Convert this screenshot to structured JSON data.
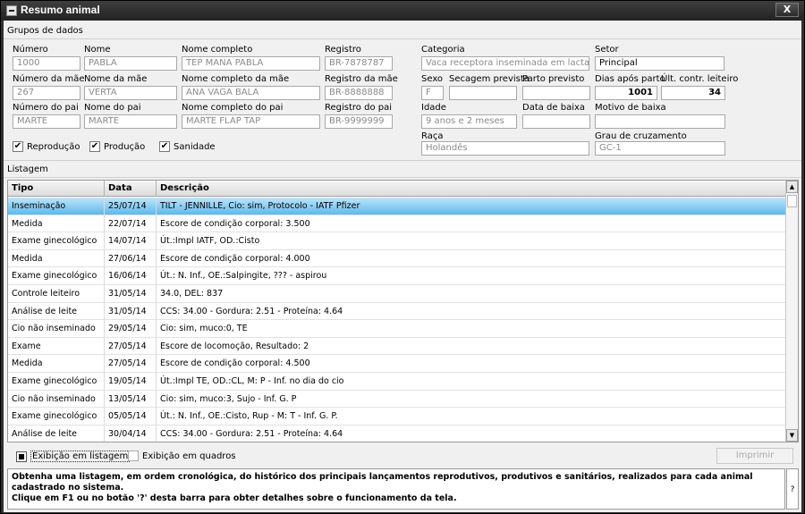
{
  "window": {
    "title": "Resumo animal",
    "close_label": "X"
  },
  "groups_label": "Grupos de dados",
  "fields": {
    "numero": {
      "label": "Número",
      "value": "1000"
    },
    "nome": {
      "label": "Nome",
      "value": "PABLA"
    },
    "nome_completo": {
      "label": "Nome completo",
      "value": "TEP MANA PABLA"
    },
    "registro": {
      "label": "Registro",
      "value": "BR-7878787"
    },
    "numero_mae": {
      "label": "Número da mãe",
      "value": "267"
    },
    "nome_mae": {
      "label": "Nome da mãe",
      "value": "VERTA"
    },
    "nome_completo_mae": {
      "label": "Nome completo da mãe",
      "value": "ANA VAGA BALA"
    },
    "registro_mae": {
      "label": "Registro da mãe",
      "value": "BR-8888888"
    },
    "numero_pai": {
      "label": "Número do pai",
      "value": "MARTE"
    },
    "nome_pai": {
      "label": "Nome do pai",
      "value": "MARTE"
    },
    "nome_completo_pai": {
      "label": "Nome completo do pai",
      "value": "MARTE FLAP TAP"
    },
    "registro_pai": {
      "label": "Registro do pai",
      "value": "BR-9999999"
    },
    "categoria": {
      "label": "Categoria",
      "value": "Vaca receptora inseminada em lactação"
    },
    "setor": {
      "label": "Setor",
      "value": "Principal"
    },
    "sexo": {
      "label": "Sexo",
      "value": "F"
    },
    "secagem": {
      "label": "Secagem prevista",
      "value": ""
    },
    "parto": {
      "label": "Parto previsto",
      "value": ""
    },
    "dias_parto": {
      "label": "Dias após parto",
      "value": "1001"
    },
    "ult_contr": {
      "label": "Últ. contr. leiteiro",
      "value": "34"
    },
    "idade": {
      "label": "Idade",
      "value": "9 anos e 2 meses"
    },
    "data_baixa": {
      "label": "Data de baixa",
      "value": ""
    },
    "motivo_baixa": {
      "label": "Motivo de baixa",
      "value": ""
    },
    "raca": {
      "label": "Raça",
      "value": "Holandês"
    },
    "grau": {
      "label": "Grau de cruzamento",
      "value": "GC-1"
    }
  },
  "checks": {
    "reproducao": "Reprodução",
    "producao": "Produção",
    "sanidade": "Sanidade",
    "mark": "✔"
  },
  "listagem_label": "Listagem",
  "columns": {
    "tipo": "Tipo",
    "data": "Data",
    "descricao": "Descrição"
  },
  "rows": [
    {
      "tipo": "Inseminação",
      "data": "25/07/14",
      "descricao": "  TILT  - JENNILLE, Cio: sim, Protocolo - IATF Pfizer"
    },
    {
      "tipo": "Medida",
      "data": "22/07/14",
      "descricao": "Escore de condição corporal: 3.500"
    },
    {
      "tipo": "Exame ginecológico",
      "data": "14/07/14",
      "descricao": "Út.:Impl IATF, OD.:Cisto"
    },
    {
      "tipo": "Medida",
      "data": "27/06/14",
      "descricao": "Escore de condição corporal: 4.000"
    },
    {
      "tipo": "Exame ginecológico",
      "data": "16/06/14",
      "descricao": "Út.: N. Inf., OE.:Salpingite, ??? - aspirou"
    },
    {
      "tipo": "Controle leiteiro",
      "data": "31/05/14",
      "descricao": "34.0, DEL: 837"
    },
    {
      "tipo": "Análise de leite",
      "data": "31/05/14",
      "descricao": "CCS: 34.00 - Gordura: 2.51 - Proteína: 4.64"
    },
    {
      "tipo": "Cio não inseminado",
      "data": "29/05/14",
      "descricao": "Cio: sim, muco:0, TE"
    },
    {
      "tipo": "Exame",
      "data": "27/05/14",
      "descricao": "Escore de locomoção, Resultado: 2"
    },
    {
      "tipo": "Medida",
      "data": "27/05/14",
      "descricao": "Escore de condição corporal: 4.500"
    },
    {
      "tipo": "Exame ginecológico",
      "data": "19/05/14",
      "descricao": "Út.:Impl TE, OD.:CL, M: P - Inf. no dia do cio"
    },
    {
      "tipo": "Cio não inseminado",
      "data": "13/05/14",
      "descricao": "Cio: sim, muco:3, Sujo - Inf. G. P"
    },
    {
      "tipo": "Exame ginecológico",
      "data": "05/05/14",
      "descricao": "Út.: N. Inf., OE.:Cisto, Rup - M: T - Inf. G. P."
    },
    {
      "tipo": "Análise de leite",
      "data": "30/04/14",
      "descricao": "CCS: 34.00 - Gordura: 2.51 - Proteína: 4.64"
    }
  ],
  "view": {
    "listagem": "Exibição em listagem",
    "quadros": "Exibição em quadros"
  },
  "print_label": "Imprimir",
  "help": {
    "line1": "Obtenha uma listagem, em ordem cronológica, do histórico dos principais lançamentos reprodutivos, produtivos e sanitários, realizados para cada animal cadastrado no sistema.",
    "line2": "Clique em F1 ou no botão '?' desta barra para obter detalhes sobre o funcionamento da tela.",
    "btn": "?"
  }
}
